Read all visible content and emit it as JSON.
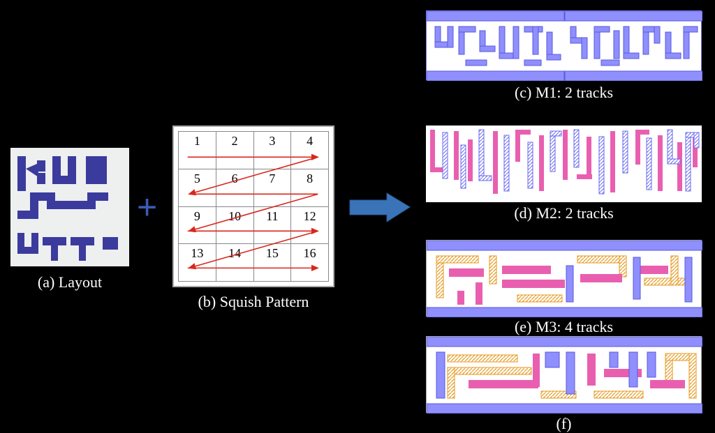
{
  "panels": {
    "a": {
      "id": "(a)",
      "caption": "Layout"
    },
    "b": {
      "id": "(b)",
      "caption": "Squish Pattern"
    },
    "c": {
      "id": "(c)",
      "caption": "M1: 2 tracks"
    },
    "d": {
      "id": "(d)",
      "caption": "M2: 2 tracks"
    },
    "e": {
      "id": "(e)",
      "caption": "M3: 4 tracks"
    },
    "f": {
      "id": "(f)",
      "caption": ""
    }
  },
  "grid": {
    "cells": [
      [
        "1",
        "2",
        "3",
        "4"
      ],
      [
        "5",
        "6",
        "7",
        "8"
      ],
      [
        "9",
        "10",
        "11",
        "12"
      ],
      [
        "13",
        "14",
        "15",
        "16"
      ]
    ]
  },
  "chart_data": {
    "type": "table",
    "title": "Squish scan order (boustrophedon)",
    "rows": 4,
    "cols": 4,
    "values": [
      [
        1,
        2,
        3,
        4
      ],
      [
        5,
        6,
        7,
        8
      ],
      [
        9,
        10,
        11,
        12
      ],
      [
        13,
        14,
        15,
        16
      ]
    ],
    "scan_order": [
      1,
      2,
      3,
      4,
      8,
      7,
      6,
      5,
      9,
      10,
      11,
      12,
      16,
      15,
      14,
      13
    ],
    "scan_path": [
      {
        "row": 0,
        "dir": "right"
      },
      {
        "row": 1,
        "dir": "left"
      },
      {
        "row": 2,
        "dir": "right"
      },
      {
        "row": 3,
        "dir": "left"
      }
    ]
  },
  "colors": {
    "metal_blue": "#3b3b9e",
    "light_blue": "#8f8ffd",
    "pink": "#e95fb0",
    "orange": "#f2b24b",
    "arrow_red": "#d9271c",
    "arrow_blue": "#3b73b9"
  }
}
